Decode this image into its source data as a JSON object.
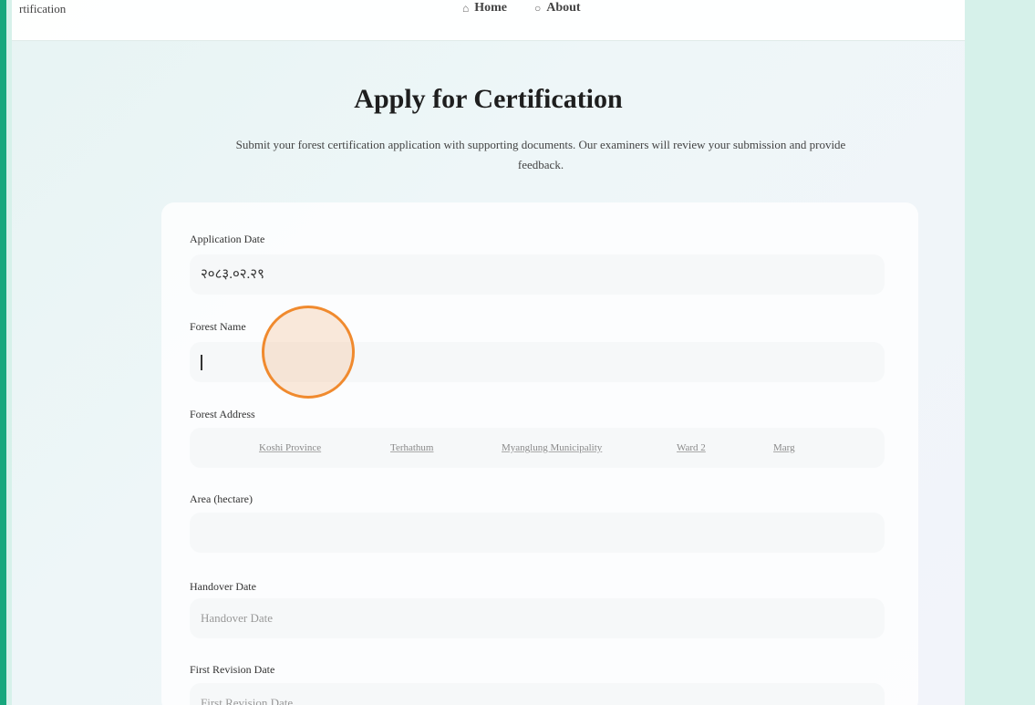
{
  "nav": {
    "brand": "rtification",
    "home_icon": "home-icon",
    "home": "Home",
    "about_icon": "info-icon",
    "about": "About"
  },
  "header": {
    "title": "Apply for Certification",
    "subtitle": "Submit your forest certification application with supporting documents. Our examiners will review your submission and provide feedback."
  },
  "form": {
    "application_date": {
      "label": "Application Date",
      "value": "२०८३.०२.२९"
    },
    "forest_name": {
      "label": "Forest Name",
      "value": ""
    },
    "forest_address": {
      "label": "Forest Address",
      "parts": [
        "Koshi Province",
        "Terhathum",
        "Myanglung Municipality",
        "Ward 2",
        "Marg"
      ]
    },
    "area": {
      "label": "Area (hectare)",
      "value": ""
    },
    "handover_date": {
      "label": "Handover Date",
      "placeholder": "Handover Date"
    },
    "first_revision_date": {
      "label": "First Revision Date",
      "placeholder": "First Revision Date"
    }
  },
  "colors": {
    "accent_green": "#17a77d",
    "click_ring": "#f08a2e"
  }
}
